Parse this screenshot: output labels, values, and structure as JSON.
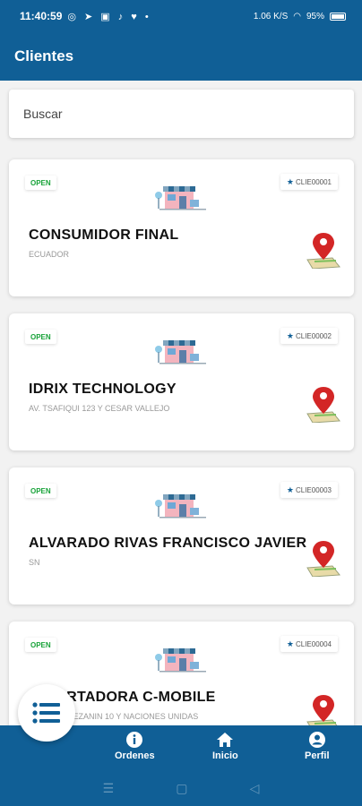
{
  "status_bar": {
    "time": "11:40:59",
    "notif_icons": "◎ ➤ ▣ ♪ ♥ •",
    "net_text": "1.06 K/S",
    "battery": "95%"
  },
  "app_bar": {
    "title": "Clientes"
  },
  "search": {
    "placeholder": "Buscar"
  },
  "clients": [
    {
      "status": "OPEN",
      "code": "CLIE00001",
      "name": "CONSUMIDOR FINAL",
      "address": "ECUADOR"
    },
    {
      "status": "OPEN",
      "code": "CLIE00002",
      "name": "IDRIX TECHNOLOGY",
      "address": "AV. TSAFIQUI 123 Y CESAR VALLEJO"
    },
    {
      "status": "OPEN",
      "code": "CLIE00003",
      "name": "ALVARADO RIVAS FRANCISCO JAVIER",
      "address": "SN"
    },
    {
      "status": "OPEN",
      "code": "CLIE00004",
      "name": "IMPORTADORA C-MOBILE",
      "address": "COLINAS MEZANIN 10 Y NACIONES UNIDAS"
    }
  ],
  "bottom_nav": {
    "items": [
      {
        "label": "Ordenes",
        "icon": "info-icon"
      },
      {
        "label": "Inicio",
        "icon": "home-icon"
      },
      {
        "label": "Perfil",
        "icon": "account-icon"
      }
    ],
    "fab_icon": "list-icon"
  },
  "colors": {
    "primary": "#105f96",
    "open_green": "#19a33a",
    "pin_red": "#d32626"
  }
}
